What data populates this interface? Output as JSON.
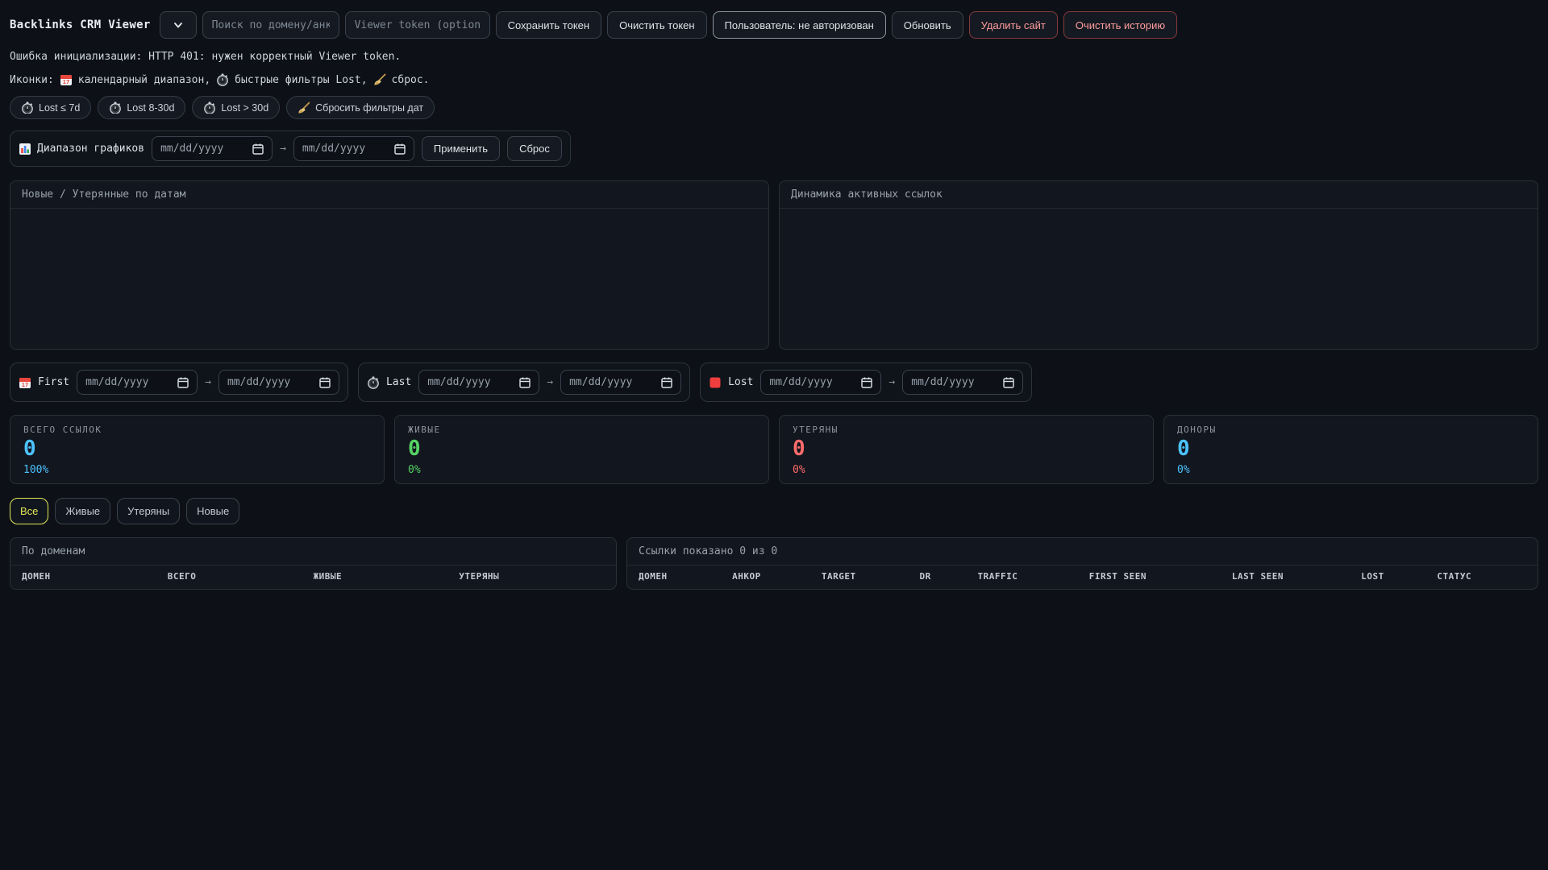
{
  "app": {
    "title": "Backlinks CRM Viewer"
  },
  "toolbar": {
    "search_placeholder": "Поиск по домену/анкору",
    "token_placeholder": "Viewer token (optional)",
    "save_token_label": "Сохранить токен",
    "clear_token_label": "Очистить токен",
    "user_status_label": "Пользователь: не авторизован",
    "refresh_label": "Обновить",
    "delete_site_label": "Удалить сайт",
    "clear_history_label": "Очистить историю"
  },
  "messages": {
    "init_error": "Ошибка инициализации: HTTP 401: нужен корректный Viewer token.",
    "legend_prefix": "Иконки:",
    "legend_calendar": "календарный диапазон,",
    "legend_stopwatch": "быстрые фильтры Lost,",
    "legend_broom": "сброс."
  },
  "quick_filters": [
    {
      "label": "Lost ≤ 7d",
      "icon": "stopwatch"
    },
    {
      "label": "Lost 8-30d",
      "icon": "stopwatch"
    },
    {
      "label": "Lost > 30d",
      "icon": "stopwatch"
    },
    {
      "label": "Сбросить фильтры дат",
      "icon": "broom"
    }
  ],
  "chart_range": {
    "label": "Диапазон графиков",
    "from_value": "mm/dd/yyyy",
    "to_value": "mm/dd/yyyy",
    "arrow": "→",
    "apply_label": "Применить",
    "reset_label": "Сброс"
  },
  "charts": {
    "new_lost_title": "Новые / Утерянные по датам",
    "active_dynamics_title": "Динамика активных ссылок"
  },
  "date_filters": {
    "first_label": "First",
    "last_label": "Last",
    "lost_label": "Lost",
    "date_value": "mm/dd/yyyy",
    "arrow": "→"
  },
  "stats": [
    {
      "label": "ВСЕГО ССЫЛОК",
      "value": "0",
      "percent": "100%",
      "color": "#4cc2ff"
    },
    {
      "label": "ЖИВЫЕ",
      "value": "0",
      "percent": "0%",
      "color": "#56d364"
    },
    {
      "label": "УТЕРЯНЫ",
      "value": "0",
      "percent": "0%",
      "color": "#ff6b6b"
    },
    {
      "label": "ДОНОРЫ",
      "value": "0",
      "percent": "0%",
      "color": "#4cc2ff"
    }
  ],
  "status_tabs": [
    {
      "label": "Все",
      "active": true
    },
    {
      "label": "Живые",
      "active": false
    },
    {
      "label": "Утеряны",
      "active": false
    },
    {
      "label": "Новые",
      "active": false
    }
  ],
  "domains_table": {
    "title": "По доменам",
    "headers": [
      "ДОМЕН",
      "ВСЕГО",
      "ЖИВЫЕ",
      "УТЕРЯНЫ"
    ],
    "rows": []
  },
  "links_table": {
    "title": "Ссылки показано 0 из 0",
    "headers": [
      "ДОМЕН",
      "АНКОР",
      "TARGET",
      "DR",
      "TRAFFIC",
      "FIRST SEEN",
      "LAST SEEN",
      "LOST",
      "СТАТУС"
    ],
    "rows": []
  },
  "colors": {
    "accent_blue": "#4cc2ff",
    "accent_green": "#56d364",
    "accent_red": "#ff6b6b",
    "tab_active": "#e2e75a",
    "danger_text": "#ff9c9c"
  }
}
